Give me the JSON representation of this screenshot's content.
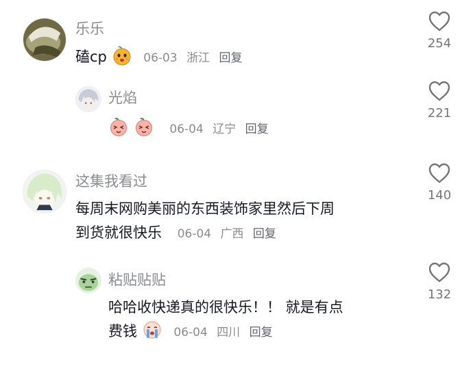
{
  "comments": [
    {
      "user": "乐乐",
      "text": "磕cp",
      "date": "06-03",
      "location": "浙江",
      "reply_label": "回复",
      "likes": "254",
      "emojis": [
        "orange-smile-emoji"
      ]
    },
    {
      "user": "光焰",
      "text": "",
      "date": "06-04",
      "location": "辽宁",
      "reply_label": "回复",
      "likes": "221",
      "emojis": [
        "peach-face-emoji",
        "peach-face-emoji"
      ]
    },
    {
      "user": "这集我看过",
      "text_line1": "每周末网购美丽的东西装饰家里然后下周",
      "text_line2": "到货就很快乐",
      "date": "06-04",
      "location": "广西",
      "reply_label": "回复",
      "likes": "140"
    },
    {
      "user": "粘贴贴贴",
      "text_line1": "哈哈收快递真的很快乐！！ 就是有点",
      "text_line2": "费钱",
      "date": "06-04",
      "location": "四川",
      "reply_label": "回复",
      "likes": "132",
      "emojis": [
        "crying-face-emoji"
      ]
    }
  ],
  "colors": {
    "name": "#8a8b91",
    "text": "#161823",
    "icon": "#73747b"
  },
  "icons": {
    "like": "heart-outline-icon"
  }
}
